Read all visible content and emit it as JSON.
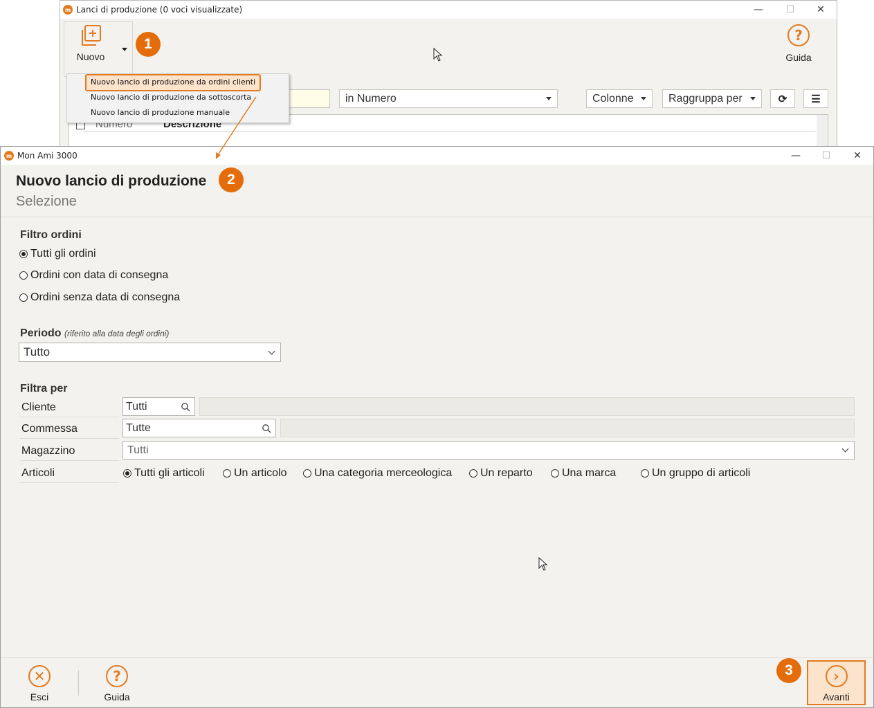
{
  "back_window": {
    "title": "Lanci di produzione (0 voci visualizzate)",
    "minimize": "—",
    "maximize": "☐",
    "close": "✕",
    "nuovo_label": "Nuovo",
    "guida_label": "Guida",
    "search_in": "in Numero",
    "colonne_label": "Colonne",
    "raggruppa_label": "Raggruppa per",
    "col_numero": "Numero",
    "col_descrizione": "Descrizione"
  },
  "menu": {
    "items": [
      "Nuovo lancio di produzione da ordini clienti",
      "Nuovo lancio di produzione da sottoscorta",
      "Nuovo lancio di produzione manuale"
    ]
  },
  "steps": [
    "1",
    "2",
    "3"
  ],
  "dialog": {
    "title": "Mon Ami 3000",
    "heading": "Nuovo lancio di produzione",
    "subheading": "Selezione",
    "filtro_ordini": {
      "label": "Filtro ordini",
      "options": [
        "Tutti gli ordini",
        "Ordini con data di consegna",
        "Ordini senza data di consegna"
      ],
      "selected": "Tutti gli ordini"
    },
    "periodo": {
      "label": "Periodo",
      "note": "(riferito alla data degli ordini)",
      "value": "Tutto"
    },
    "filtra_per": {
      "label": "Filtra per",
      "cliente_label": "Cliente",
      "cliente_value": "Tutti",
      "commessa_label": "Commessa",
      "commessa_value": "Tutte",
      "magazzino_label": "Magazzino",
      "magazzino_value": "Tutti",
      "articoli_label": "Articoli",
      "articoli_options": [
        "Tutti gli articoli",
        "Un articolo",
        "Una categoria merceologica",
        "Un reparto",
        "Una marca",
        "Un gruppo di articoli"
      ],
      "articoli_selected": "Tutti gli articoli"
    },
    "footer": {
      "esci": "Esci",
      "guida": "Guida",
      "avanti": "Avanti"
    }
  },
  "colors": {
    "accent": "#e37a1f",
    "badge": "#e46c0a",
    "panel": "#f3f2ee"
  }
}
